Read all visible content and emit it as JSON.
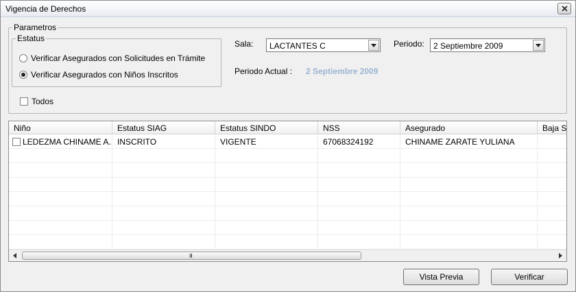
{
  "window": {
    "title": "Vigencia de Derechos"
  },
  "parametros": {
    "legend": "Parametros",
    "estatus": {
      "legend": "Estatus",
      "options": [
        {
          "label": "Verificar Asegurados con Solicitudes en Trámite",
          "selected": false
        },
        {
          "label": "Verificar Asegurados con Niños Inscritos",
          "selected": true
        }
      ]
    },
    "todos": {
      "label": "Todos",
      "checked": false
    },
    "sala": {
      "label": "Sala:",
      "value": "LACTANTES C"
    },
    "periodo": {
      "label": "Periodo:",
      "value": "2 Septiembre 2009"
    },
    "periodo_actual": {
      "label": "Periodo Actual :",
      "value": "2 Septiembre 2009"
    }
  },
  "grid": {
    "columns": [
      "Niño",
      "Estatus SIAG",
      "Estatus SINDO",
      "NSS",
      "Asegurado",
      "Baja SI"
    ],
    "rows": [
      {
        "checked": false,
        "cells": [
          "LEDEZMA CHINAME A...",
          "INSCRITO",
          "VIGENTE",
          "67068324192",
          "CHINAME ZARATE YULIANA",
          ""
        ]
      }
    ],
    "scroll_grip": "III"
  },
  "buttons": {
    "preview": "Vista Previa",
    "verify": "Verificar"
  },
  "colors": {
    "periodo_actual": "#9bb5d3"
  }
}
